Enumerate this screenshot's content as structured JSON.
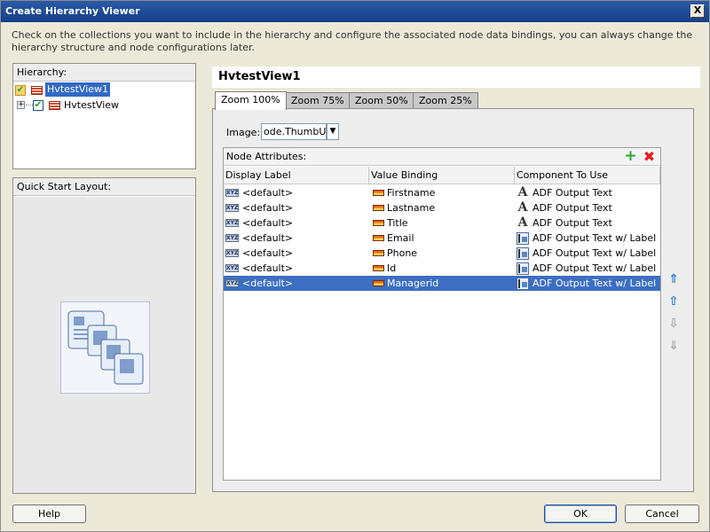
{
  "window": {
    "title": "Create Hierarchy Viewer",
    "close_label": "X"
  },
  "description": "Check on the collections you want to include in the hierarchy and configure the associated node data bindings, you can always change the hierarchy structure and node configurations later.",
  "hierarchy": {
    "label": "Hierarchy:",
    "items": [
      {
        "label": "HvtestView1",
        "checked": true,
        "selected": true,
        "level": 0
      },
      {
        "label": "HvtestView",
        "checked": true,
        "selected": false,
        "level": 1,
        "expander": "+"
      }
    ]
  },
  "quick_start": {
    "label": "Quick Start Layout:"
  },
  "node": {
    "title": "HvtestView1",
    "tabs": [
      {
        "label": "Zoom 100%",
        "active": true
      },
      {
        "label": "Zoom 75%",
        "active": false
      },
      {
        "label": "Zoom 50%",
        "active": false
      },
      {
        "label": "Zoom 25%",
        "active": false
      }
    ],
    "image_label": "Image:",
    "image_value": "ode.ThumbUrl}",
    "attributes_label": "Node Attributes:",
    "add_icon": "+",
    "delete_icon": "✖",
    "columns": [
      "Display Label",
      "Value Binding",
      "Component To Use"
    ],
    "rows": [
      {
        "display": "<default>",
        "binding": "Firstname",
        "component": "ADF Output Text",
        "comp_icon": "A",
        "selected": false
      },
      {
        "display": "<default>",
        "binding": "Lastname",
        "component": "ADF Output Text",
        "comp_icon": "A",
        "selected": false
      },
      {
        "display": "<default>",
        "binding": "Title",
        "component": "ADF Output Text",
        "comp_icon": "A",
        "selected": false
      },
      {
        "display": "<default>",
        "binding": "Email",
        "component": "ADF Output Text w/ Label",
        "comp_icon": "label",
        "selected": false
      },
      {
        "display": "<default>",
        "binding": "Phone",
        "component": "ADF Output Text w/ Label",
        "comp_icon": "label",
        "selected": false
      },
      {
        "display": "<default>",
        "binding": "Id",
        "component": "ADF Output Text w/ Label",
        "comp_icon": "label",
        "selected": false
      },
      {
        "display": "<default>",
        "binding": "Managerid",
        "component": "ADF Output Text w/ Label",
        "comp_icon": "label",
        "selected": true
      }
    ],
    "xyz_icon": "XYZ",
    "move_buttons": [
      {
        "name": "move-top-button",
        "glyph": "⇑",
        "enabled": true
      },
      {
        "name": "move-up-button",
        "glyph": "⇧",
        "enabled": true
      },
      {
        "name": "move-down-button",
        "glyph": "⇩",
        "enabled": false
      },
      {
        "name": "move-bottom-button",
        "glyph": "⇓",
        "enabled": false
      }
    ]
  },
  "buttons": {
    "help": "Help",
    "ok": "OK",
    "cancel": "Cancel"
  }
}
